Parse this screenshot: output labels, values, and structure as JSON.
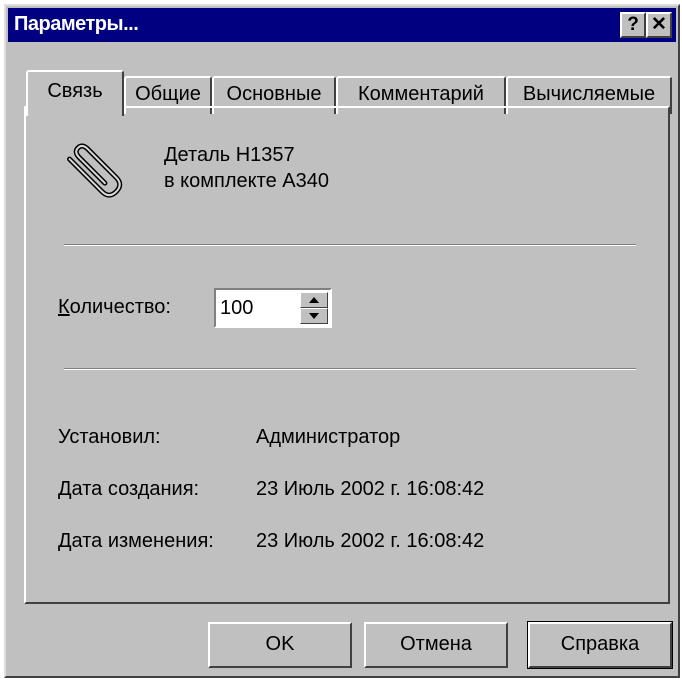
{
  "window": {
    "title": "Параметры..."
  },
  "titlebar_buttons": {
    "help": "?",
    "close": "✕"
  },
  "tabs": [
    {
      "label": "Связь",
      "active": true
    },
    {
      "label": "Общие",
      "active": false
    },
    {
      "label": "Основные",
      "active": false
    },
    {
      "label": "Комментарий",
      "active": false
    },
    {
      "label": "Вычисляемые",
      "active": false
    }
  ],
  "object": {
    "icon": "paperclip-icon",
    "line1": "Деталь H1357",
    "line2": "в комплекте A340"
  },
  "quantity": {
    "label": "Количество:",
    "value": "100"
  },
  "info": {
    "installed_label": "Установил:",
    "installed_value": "Администратор",
    "created_label": "Дата создания:",
    "created_value": "23 Июль 2002 г. 16:08:42",
    "modified_label": "Дата изменения:",
    "modified_value": "23 Июль 2002 г. 16:08:42"
  },
  "buttons": {
    "ok": "OK",
    "cancel": "Отмена",
    "help": "Справка"
  }
}
